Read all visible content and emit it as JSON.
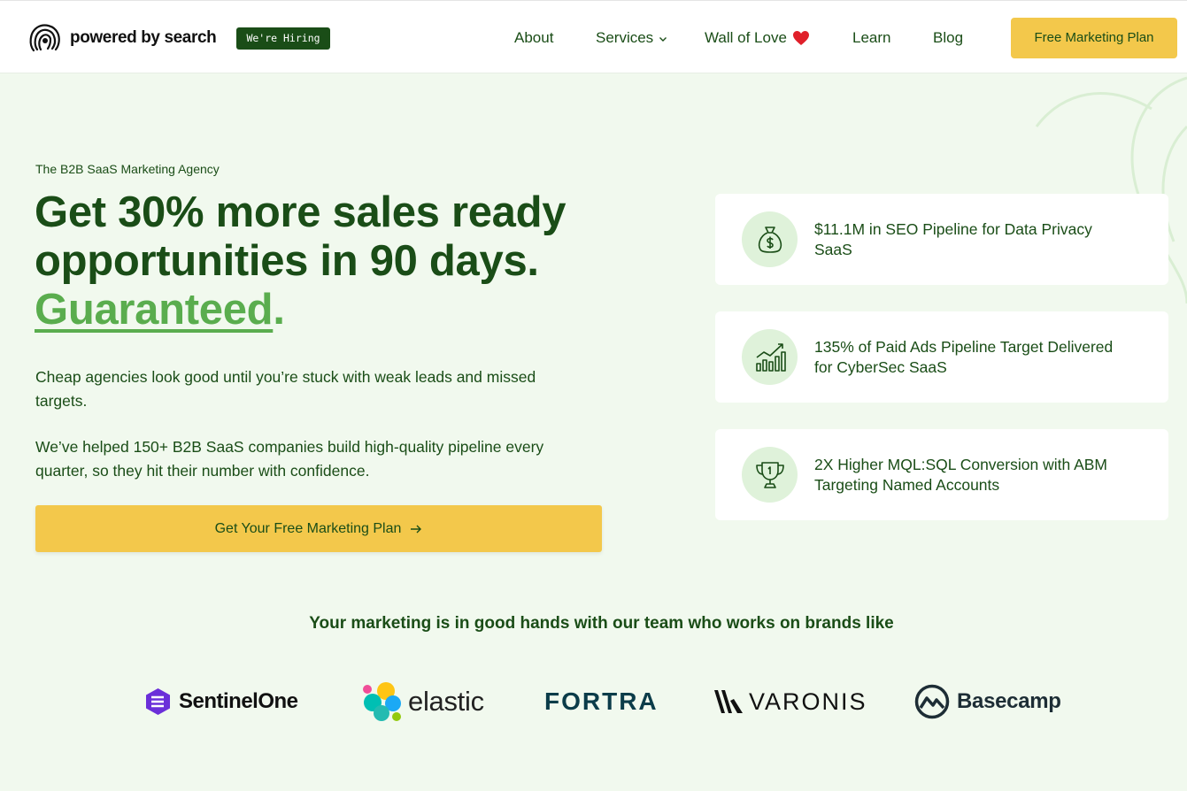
{
  "header": {
    "brand_name": "powered by search",
    "hiring_badge": "We're Hiring",
    "nav": [
      {
        "label": "About"
      },
      {
        "label": "Services"
      },
      {
        "label": "Wall of Love"
      },
      {
        "label": "Learn"
      },
      {
        "label": "Blog"
      }
    ],
    "cta_label": "Free Marketing Plan"
  },
  "hero": {
    "eyebrow": "The B2B SaaS Marketing Agency",
    "headline_line1": "Get 30% more sales ready",
    "headline_line2": "opportunities in 90 days.",
    "headline_highlight": "Guaranteed",
    "headline_period": ".",
    "paragraph1": "Cheap agencies look good until you’re stuck with weak leads and missed targets.",
    "paragraph2": "We’ve helped 150+ B2B SaaS companies build high-quality pipeline every quarter, so they hit their number with confidence.",
    "cta_label": "Get Your Free Marketing Plan"
  },
  "stats": [
    {
      "icon": "money-bag-icon",
      "text": "$11.1M in SEO Pipeline for Data Privacy SaaS"
    },
    {
      "icon": "growth-chart-icon",
      "text": "135% of Paid Ads Pipeline Target Delivered for CyberSec SaaS"
    },
    {
      "icon": "trophy-icon",
      "text": "2X Higher MQL:SQL Conversion with ABM Targeting Named Accounts"
    }
  ],
  "brands": {
    "title": "Your marketing is in good hands with our team who works on brands like",
    "logos": [
      {
        "name": "SentinelOne"
      },
      {
        "name": "elastic"
      },
      {
        "name": "FORTRA"
      },
      {
        "name": "VARONIS"
      },
      {
        "name": "Basecamp"
      }
    ]
  },
  "colors": {
    "primary_green": "#1a4d17",
    "accent_green": "#5aad4e",
    "cta_yellow": "#f3c84b",
    "background": "#f1f9ee"
  }
}
